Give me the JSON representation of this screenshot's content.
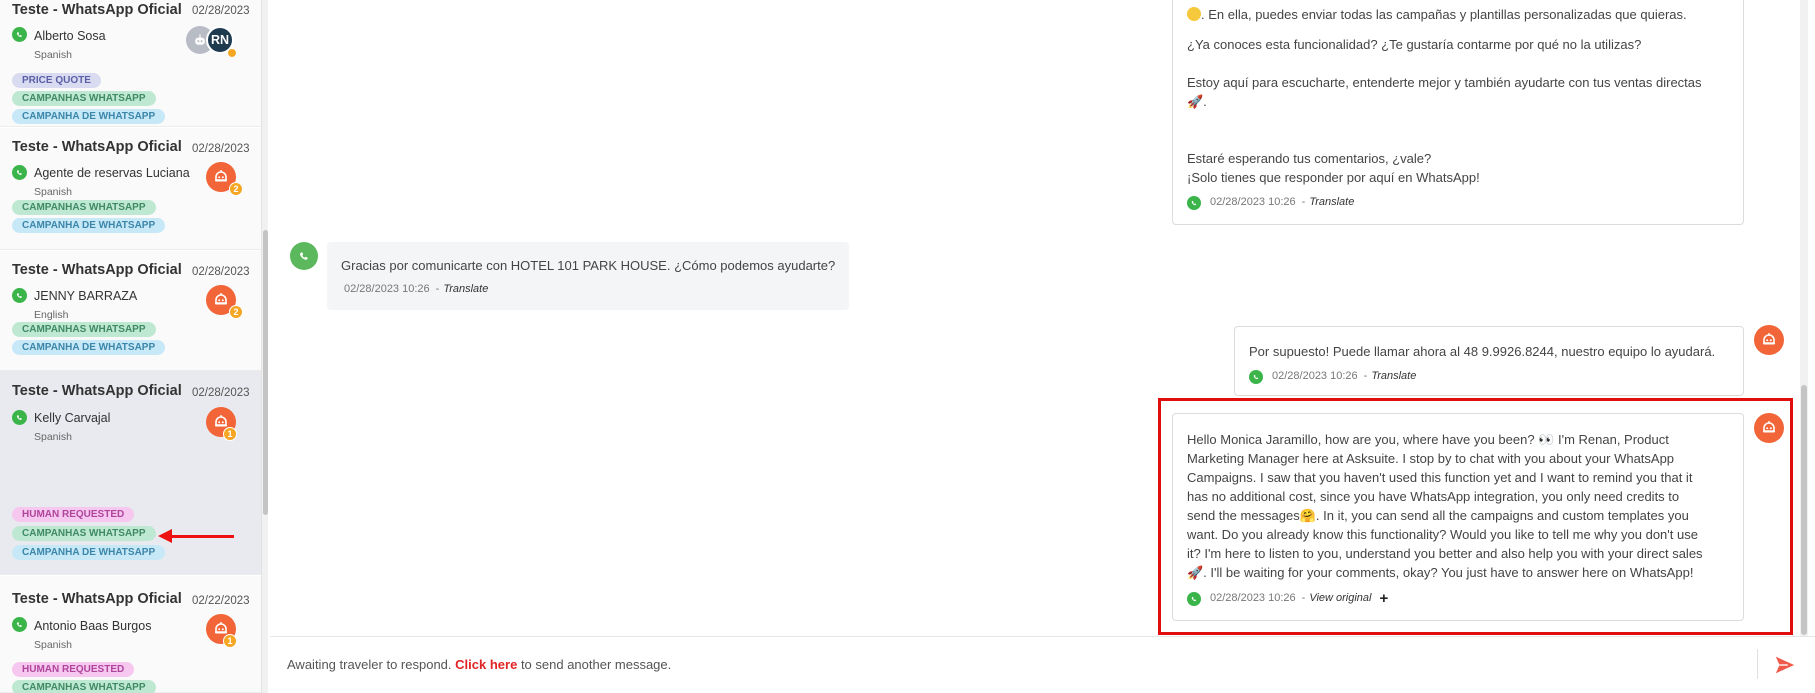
{
  "sidebar": {
    "conversations": [
      {
        "title": "Teste - WhatsApp Oficial",
        "date": "02/28/2023",
        "name": "Alberto Sosa",
        "language": "Spanish",
        "avatar_initials": "RN",
        "tags": [
          "PRICE QUOTE",
          "CAMPANHAS WHATSAPP",
          "CAMPANHA DE WHATSAPP"
        ]
      },
      {
        "title": "Teste - WhatsApp Oficial",
        "date": "02/28/2023",
        "name": "Agente de reservas Luciana",
        "language": "Spanish",
        "badge": "2",
        "tags": [
          "CAMPANHAS WHATSAPP",
          "CAMPANHA DE WHATSAPP"
        ]
      },
      {
        "title": "Teste - WhatsApp Oficial",
        "date": "02/28/2023",
        "name": "JENNY BARRAZA",
        "language": "English",
        "badge": "2",
        "tags": [
          "CAMPANHAS WHATSAPP",
          "CAMPANHA DE WHATSAPP"
        ]
      },
      {
        "title": "Teste - WhatsApp Oficial",
        "date": "02/28/2023",
        "name": "Kelly Carvajal",
        "language": "Spanish",
        "badge": "1",
        "tags": [
          "HUMAN REQUESTED",
          "CAMPANHAS WHATSAPP",
          "CAMPANHA DE WHATSAPP"
        ]
      },
      {
        "title": "Teste - WhatsApp Oficial",
        "date": "02/22/2023",
        "name": "Antonio Baas Burgos",
        "language": "Spanish",
        "badge": "1",
        "tags": [
          "HUMAN REQUESTED",
          "CAMPANHAS WHATSAPP"
        ]
      }
    ]
  },
  "chat": {
    "msg1": {
      "line1": ". En ella, puedes enviar todas las campañas y plantillas personalizadas que quieras.",
      "line2": "¿Ya conoces esta funcionalidad? ¿Te gustaría contarme por qué no la utilizas?",
      "line3": "Estoy aquí para escucharte, entenderte mejor y también ayudarte con tus ventas directas",
      "line3b": "🚀.",
      "line4": "Estaré esperando tus comentarios, ¿vale?",
      "line5": "¡Solo tienes que responder por aquí en WhatsApp!",
      "time": "02/28/2023 10:26",
      "sep": "-",
      "action": "Translate"
    },
    "msg2": {
      "text": "Gracias por comunicarte con HOTEL 101 PARK HOUSE. ¿Cómo podemos ayudarte?",
      "time": "02/28/2023 10:26",
      "sep": "-",
      "action": "Translate"
    },
    "msg3": {
      "text": "Por supuesto! Puede llamar ahora al 48 9.9926.8244, nuestro equipo lo ayudará.",
      "time": "02/28/2023 10:26",
      "sep": "-",
      "action": "Translate"
    },
    "msg4": {
      "lines": [
        "Hello Monica Jaramillo, how are you, where have you been? 👀 I'm Renan, Product",
        "Marketing Manager here at Asksuite. I stop by to chat with you about your WhatsApp",
        "Campaigns. I saw that you haven't used this function yet and I want to remind you that it",
        "has no additional cost, since you have WhatsApp integration, you only need credits to",
        "send the messages🤗. In it, you can send all the campaigns and custom templates you",
        "want. Do you already know this functionality? Would you like to tell me why you don't use",
        "it? I'm here to listen to you, understand you better and also help you with your direct sales",
        "🚀. I'll be waiting for your comments, okay? You just have to answer here on WhatsApp!"
      ],
      "time": "02/28/2023 10:26",
      "sep": "-",
      "action": "View original",
      "plus": "+"
    }
  },
  "footer": {
    "text_before": "Awaiting traveler to respond.",
    "link": "Click here",
    "text_after": "to send another message."
  },
  "colors": {
    "accent_red": "#e02424",
    "bot_orange": "#f26538",
    "whatsapp_green": "#3bb54a"
  },
  "icons": [
    "whatsapp-icon",
    "robot-icon",
    "send-icon",
    "eyes-emoji",
    "rocket-emoji",
    "hug-emoji"
  ]
}
